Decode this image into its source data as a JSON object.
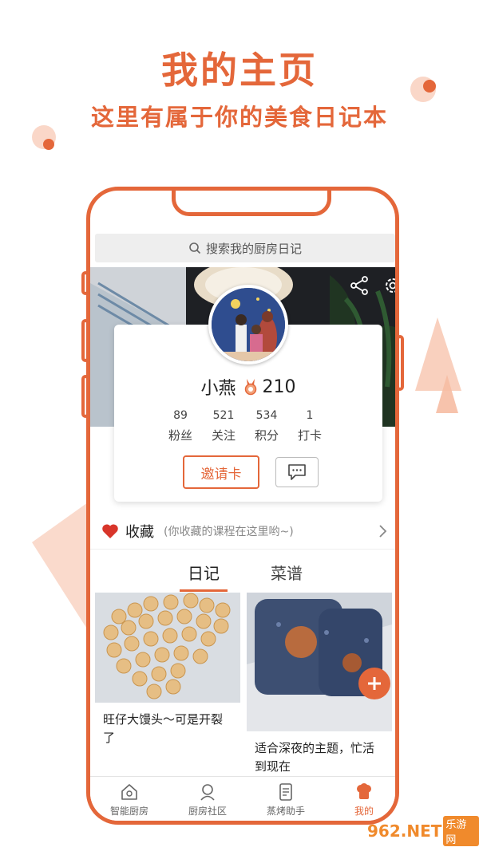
{
  "promo": {
    "headline": "我的主页",
    "subline": "这里有属于你的美食日记本"
  },
  "colors": {
    "accent": "#e4673a",
    "deco_light": "#f6bca3"
  },
  "search": {
    "placeholder": "搜索我的厨房日记",
    "icon": "search-icon"
  },
  "header_icons": [
    "share-icon",
    "gear-icon"
  ],
  "profile": {
    "name": "小燕",
    "medal_icon": "medal-icon",
    "score": "210",
    "stats": [
      {
        "value": "89",
        "label": "粉丝"
      },
      {
        "value": "521",
        "label": "关注"
      },
      {
        "value": "534",
        "label": "积分"
      },
      {
        "value": "1",
        "label": "打卡"
      }
    ],
    "invite_label": "邀请卡",
    "message_icon": "message-icon"
  },
  "favorites": {
    "icon": "heart-icon",
    "title": "收藏",
    "hint": "(你收藏的课程在这里哟~)"
  },
  "tabs": [
    {
      "label": "日记",
      "active": true
    },
    {
      "label": "菜谱",
      "active": false
    }
  ],
  "cards": [
    {
      "caption": "旺仔大馒头～可是开裂了"
    },
    {
      "caption": "适合深夜的主题，忙活到现在"
    }
  ],
  "tabbar": [
    {
      "label": "智能厨房",
      "icon": "kitchen-icon",
      "active": false
    },
    {
      "label": "厨房社区",
      "icon": "community-icon",
      "active": false
    },
    {
      "label": "蒸烤助手",
      "icon": "assistant-icon",
      "active": false
    },
    {
      "label": "我的",
      "icon": "chef-icon",
      "active": true
    }
  ],
  "watermark": {
    "brand": "962.NET",
    "sub": "乐游网"
  }
}
